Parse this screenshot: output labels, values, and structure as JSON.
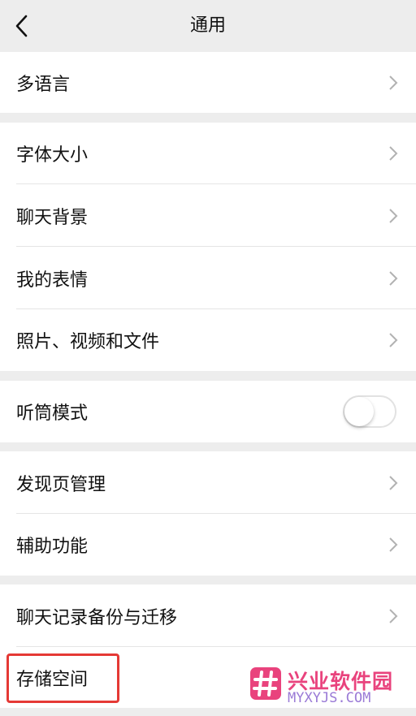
{
  "header": {
    "title": "通用"
  },
  "groups": [
    {
      "items": [
        {
          "label": "多语言"
        }
      ]
    },
    {
      "items": [
        {
          "label": "字体大小"
        },
        {
          "label": "聊天背景"
        },
        {
          "label": "我的表情"
        },
        {
          "label": "照片、视频和文件"
        }
      ]
    },
    {
      "items": [
        {
          "label": "听筒模式",
          "toggle_on": false
        }
      ]
    },
    {
      "items": [
        {
          "label": "发现页管理"
        },
        {
          "label": "辅助功能"
        }
      ]
    },
    {
      "items": [
        {
          "label": "聊天记录备份与迁移"
        },
        {
          "label": "存储空间"
        }
      ]
    }
  ],
  "watermark": {
    "name": "兴业软件园",
    "domain": "MYXYJS.COM"
  },
  "colors": {
    "highlight": "#e53935",
    "background": "#ededed",
    "watermark": "#e9437d"
  }
}
